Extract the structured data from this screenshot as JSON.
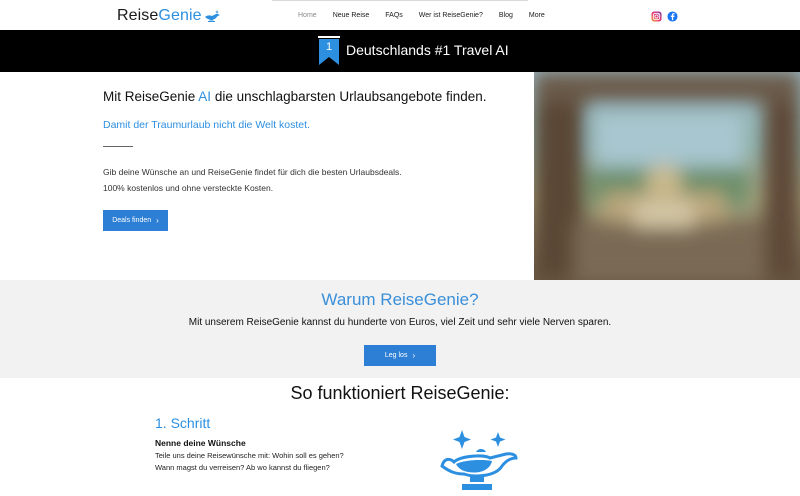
{
  "header": {
    "logo": {
      "text_main": "Reise",
      "text_accent": "Genie"
    },
    "nav": [
      {
        "label": "Home",
        "active": true
      },
      {
        "label": "Neue Reise",
        "active": false
      },
      {
        "label": "FAQs",
        "active": false
      },
      {
        "label": "Wer ist ReiseGenie?",
        "active": false
      },
      {
        "label": "Blog",
        "active": false
      },
      {
        "label": "More",
        "active": false
      }
    ],
    "social": [
      "instagram-icon",
      "facebook-icon"
    ]
  },
  "banner": {
    "rank": "1",
    "title": "Deutschlands #1 Travel AI"
  },
  "hero": {
    "title_pre": "Mit ReiseGenie ",
    "title_ai": "AI",
    "title_post": " die unschlagbarsten Urlaubsangebote finden.",
    "subtitle": "Damit der Traumurlaub nicht die Welt kostet.",
    "text_line1": "Gib deine Wünsche an und ReiseGenie findet für dich die besten Urlaubsdeals.",
    "text_line2": "100% kostenlos und ohne versteckte Kosten.",
    "button": "Deals finden"
  },
  "warum": {
    "title": "Warum ReiseGenie?",
    "text": "Mit unserem ReiseGenie kannst du hunderte von Euros, viel Zeit und sehr viele Nerven sparen.",
    "button": "Leg los"
  },
  "how": {
    "title": "So funktioniert ReiseGenie:",
    "step_title": "1. Schritt",
    "step_head": "Nenne deine Wünsche",
    "step_line1": "Teile uns deine Reisewünsche mit: Wohin soll es gehen?",
    "step_line2": "Wann magst du verreisen? Ab wo kannst du fliegen?"
  },
  "colors": {
    "accent": "#2d8fe0",
    "button": "#2d7fd6",
    "banner": "#000000",
    "section_bg": "#f2f2f2"
  }
}
